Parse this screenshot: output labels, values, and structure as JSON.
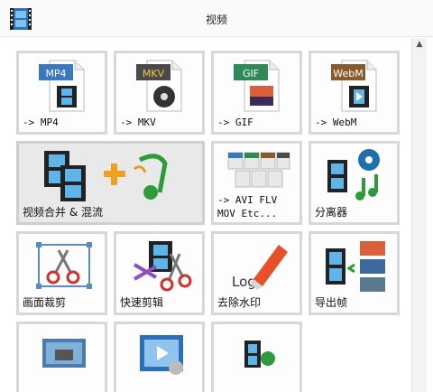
{
  "window": {
    "title": "视频"
  },
  "tiles": [
    {
      "label": "-> MP4",
      "badge": "MP4",
      "badge_color": "#3a78c4"
    },
    {
      "label": "-> MKV",
      "badge": "MKV",
      "badge_color": "#4a4a4a"
    },
    {
      "label": "-> GIF",
      "badge": "GIF",
      "badge_color": "#2e8b57"
    },
    {
      "label": "-> WebM",
      "badge": "WebM",
      "badge_color": "#8a5a2b"
    },
    {
      "label": "视频合并 & 混流"
    },
    {
      "label": "-> AVI FLV\nMOV Etc...",
      "mini_badges": [
        "AVI",
        "FLV",
        "MOV",
        "WMV"
      ]
    },
    {
      "label": "分离器"
    },
    {
      "label": "画面裁剪"
    },
    {
      "label": "快速剪辑"
    },
    {
      "label": "去除水印",
      "logo_text": "Logo"
    },
    {
      "label": "导出帧"
    },
    {
      "label": ""
    },
    {
      "label": ""
    },
    {
      "label": ""
    }
  ]
}
